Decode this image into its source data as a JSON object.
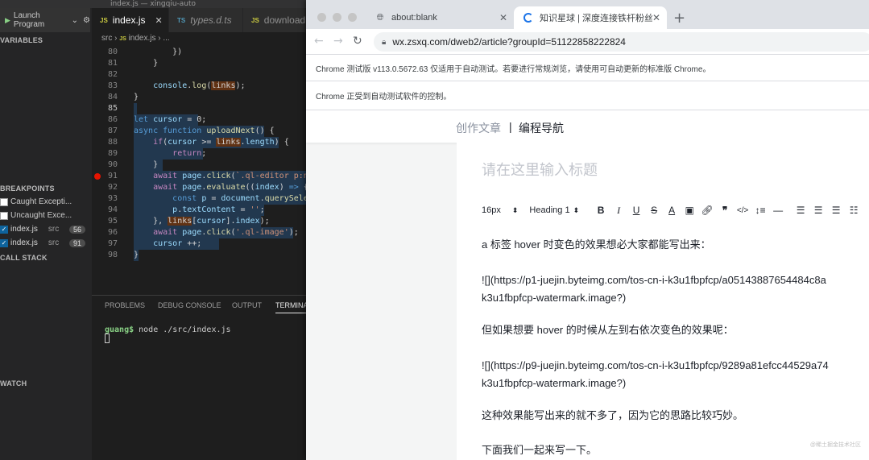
{
  "vscode": {
    "window_title": "index.js — xingqiu-auto",
    "launch_label": "Launch Program",
    "tabs": [
      {
        "badge": "JS",
        "label": "index.js"
      },
      {
        "badge": "TS",
        "label": "types.d.ts"
      },
      {
        "badge": "JS",
        "label": "download.js"
      }
    ],
    "breadcrumb": {
      "folder": "src",
      "badge": "JS",
      "file": "index.js",
      "rest": "..."
    },
    "sidebar": {
      "variables": "VARIABLES",
      "breakpoints": "BREAKPOINTS",
      "call_stack": "CALL STACK",
      "watch": "WATCH",
      "bp_items": [
        {
          "label": "Caught Excepti...",
          "checked": false
        },
        {
          "label": "Uncaught Exce...",
          "checked": false
        },
        {
          "label": "index.js",
          "src": "src",
          "count": "56",
          "checked": true
        },
        {
          "label": "index.js",
          "src": "src",
          "count": "91",
          "checked": true
        }
      ]
    },
    "code_lines": [
      "80",
      "81",
      "82",
      "83",
      "84",
      "85",
      "86",
      "87",
      "88",
      "89",
      "90",
      "91",
      "92",
      "93",
      "94",
      "95",
      "96",
      "97",
      "98"
    ],
    "panel": {
      "tabs": [
        "PROBLEMS",
        "DEBUG CONSOLE",
        "OUTPUT",
        "TERMINAL"
      ],
      "prompt_user": "guang$",
      "command": " node ./src/index.js"
    }
  },
  "chrome": {
    "tabs": [
      {
        "title": "about:blank"
      },
      {
        "title": "知识星球 | 深度连接铁杆粉丝, 运"
      }
    ],
    "url": "wx.zsxq.com/dweb2/article?groupId=51122858222824",
    "infobar1": "Chrome 测试版 v113.0.5672.63 仅适用于自动测试。若要进行常规浏览，请使用可自动更新的标准版 Chrome。",
    "infobar2": "Chrome 正受到自动测试软件的控制。",
    "page": {
      "crumb1": "创作文章",
      "sep": "|",
      "crumb2": "编程导航",
      "title_placeholder": "请在这里输入标题",
      "font_size": "16px",
      "heading": "Heading 1",
      "paragraphs": [
        "a 标签 hover 时变色的效果想必大家都能写出来：",
        "![](https://p1-juejin.byteimg.com/tos-cn-i-k3u1fbpfcp/a05143887654484c8a",
        "k3u1fbpfcp-watermark.image?)",
        "但如果想要 hover 的时候从左到右依次变色的效果呢：",
        "![](https://p9-juejin.byteimg.com/tos-cn-i-k3u1fbpfcp/9289a81efcc44529a74",
        "k3u1fbpfcp-watermark.image?)",
        "这种效果能写出来的就不多了，因为它的思路比较巧妙。",
        "下面我们一起来写一下。"
      ],
      "watermark": "@稀土掘金技术社区"
    }
  },
  "colors": {
    "vscode_bg": "#1e1e1e",
    "breakpoint": "#e51400",
    "accent": "#1a73e8"
  }
}
